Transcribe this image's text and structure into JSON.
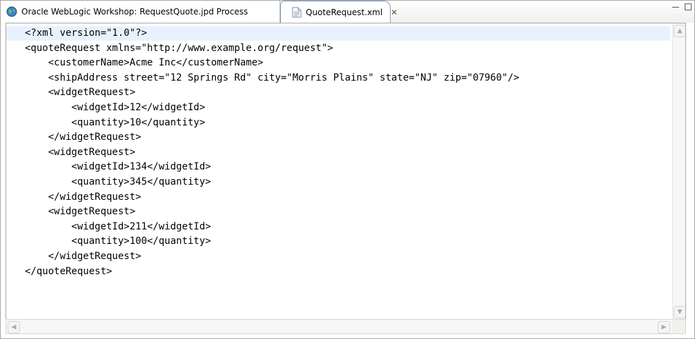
{
  "tabs": [
    {
      "label": "Oracle WebLogic Workshop: RequestQuote.jpd Process",
      "icon": "globe-icon",
      "active": false
    },
    {
      "label": "QuoteRequest.xml",
      "icon": "xml-file-icon",
      "active": true,
      "close_glyph": "✕"
    }
  ],
  "editor": {
    "lines": [
      "<?xml version=\"1.0\"?>",
      "<quoteRequest xmlns=\"http://www.example.org/request\">",
      "    <customerName>Acme Inc</customerName>",
      "    <shipAddress street=\"12 Springs Rd\" city=\"Morris Plains\" state=\"NJ\" zip=\"07960\"/>",
      "    <widgetRequest>",
      "        <widgetId>12</widgetId>",
      "        <quantity>10</quantity>",
      "    </widgetRequest>",
      "    <widgetRequest>",
      "        <widgetId>134</widgetId>",
      "        <quantity>345</quantity>",
      "    </widgetRequest>",
      "    <widgetRequest>",
      "        <widgetId>211</widgetId>",
      "        <quantity>100</quantity>",
      "    </widgetRequest>",
      "</quoteRequest>"
    ]
  },
  "colors": {
    "current_line": "#e8f2fe",
    "tab_border": "#7f9db9"
  }
}
